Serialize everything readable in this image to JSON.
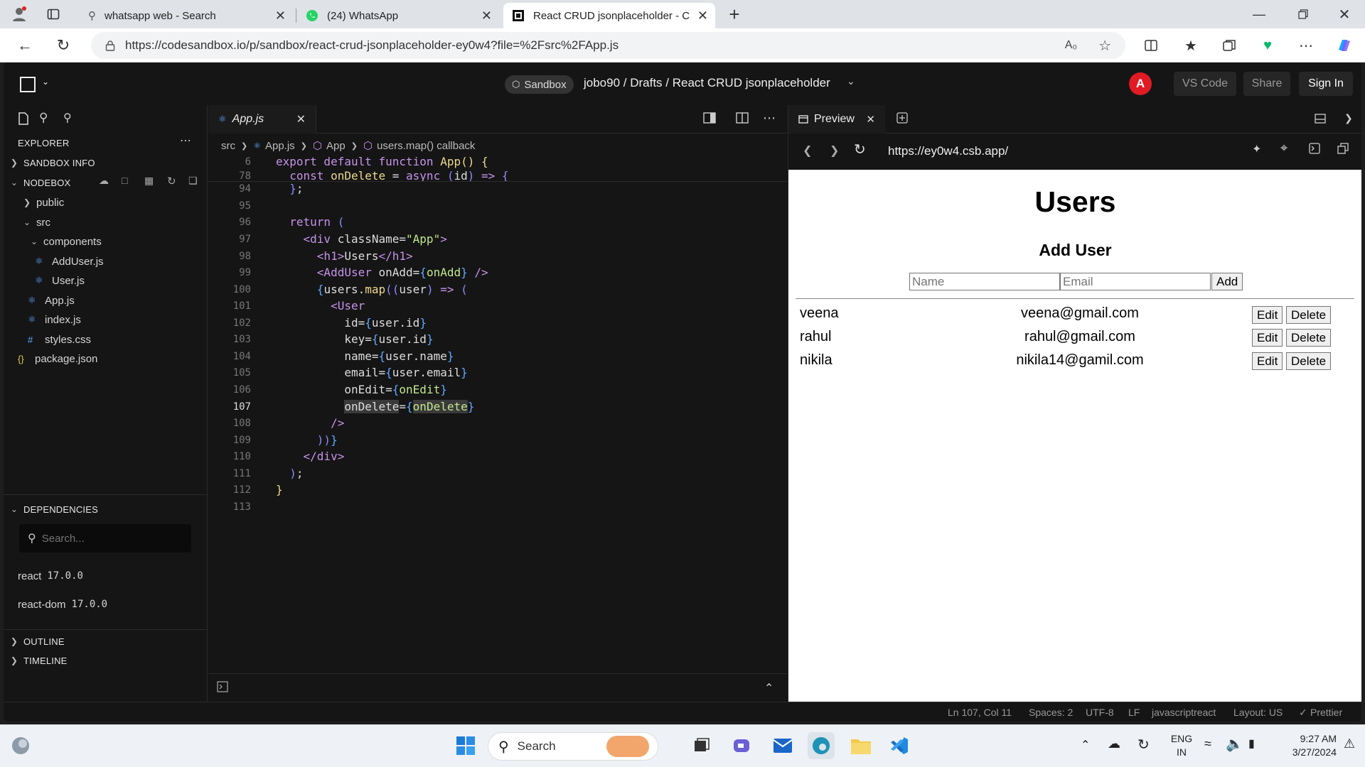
{
  "browser": {
    "tabs": [
      {
        "title": "whatsapp web - Search",
        "icon": "search-icon"
      },
      {
        "title": "(24) WhatsApp",
        "icon": "whatsapp-icon"
      },
      {
        "title": "React CRUD jsonplaceholder - Co",
        "icon": "codesandbox-icon"
      }
    ],
    "url": "https://codesandbox.io/p/sandbox/react-crud-jsonplaceholder-ey0w4?file=%2Fsrc%2FApp.js"
  },
  "header": {
    "sandbox_badge": "Sandbox",
    "breadcrumb": "jobo90 / Drafts / React CRUD jsonplaceholder",
    "avatar": "A",
    "vscode": "VS Code",
    "share": "Share",
    "signin": "Sign In"
  },
  "sidebar": {
    "explorer": "EXPLORER",
    "sandbox_info": "SANDBOX INFO",
    "nodebox": "NODEBOX",
    "tree": {
      "public": "public",
      "src": "src",
      "components": "components",
      "adduser": "AddUser.js",
      "user": "User.js",
      "app": "App.js",
      "index": "index.js",
      "styles": "styles.css",
      "package": "package.json"
    },
    "dependencies": "DEPENDENCIES",
    "dep_search_placeholder": "Search...",
    "deps": [
      {
        "name": "react",
        "version": "17.0.0"
      },
      {
        "name": "react-dom",
        "version": "17.0.0"
      }
    ],
    "outline": "OUTLINE",
    "timeline": "TIMELINE"
  },
  "editor": {
    "tab": "App.js",
    "breadcrumb": {
      "src": "src",
      "file": "App.js",
      "component": "App",
      "callback": "users.map() callback"
    },
    "sticky": [
      {
        "ln": "6",
        "code": "export default function App() {"
      },
      {
        "ln": "78",
        "code": "  const onDelete = async (id) => {"
      }
    ],
    "lines": [
      "94",
      "95",
      "96",
      "97",
      "98",
      "99",
      "100",
      "101",
      "102",
      "103",
      "104",
      "105",
      "106",
      "107",
      "108",
      "109",
      "110",
      "111",
      "112",
      "113"
    ]
  },
  "preview": {
    "tab": "Preview",
    "url": "https://ey0w4.csb.app/",
    "title": "Users",
    "subtitle": "Add User",
    "name_placeholder": "Name",
    "email_placeholder": "Email",
    "add": "Add",
    "users": [
      {
        "name": "veena",
        "email": "veena@gmail.com"
      },
      {
        "name": "rahul",
        "email": "rahul@gmail.com"
      },
      {
        "name": "nikila",
        "email": "nikila14@gamil.com"
      }
    ],
    "edit": "Edit",
    "delete": "Delete"
  },
  "status": {
    "position": "Ln 107, Col 11",
    "spaces": "Spaces: 2",
    "encoding": "UTF-8",
    "eol": "LF",
    "language": "javascriptreact",
    "layout": "Layout: US",
    "prettier": "Prettier"
  },
  "taskbar": {
    "search": "Search",
    "lang1": "ENG",
    "lang2": "IN",
    "time": "9:27 AM",
    "date": "3/27/2024"
  }
}
